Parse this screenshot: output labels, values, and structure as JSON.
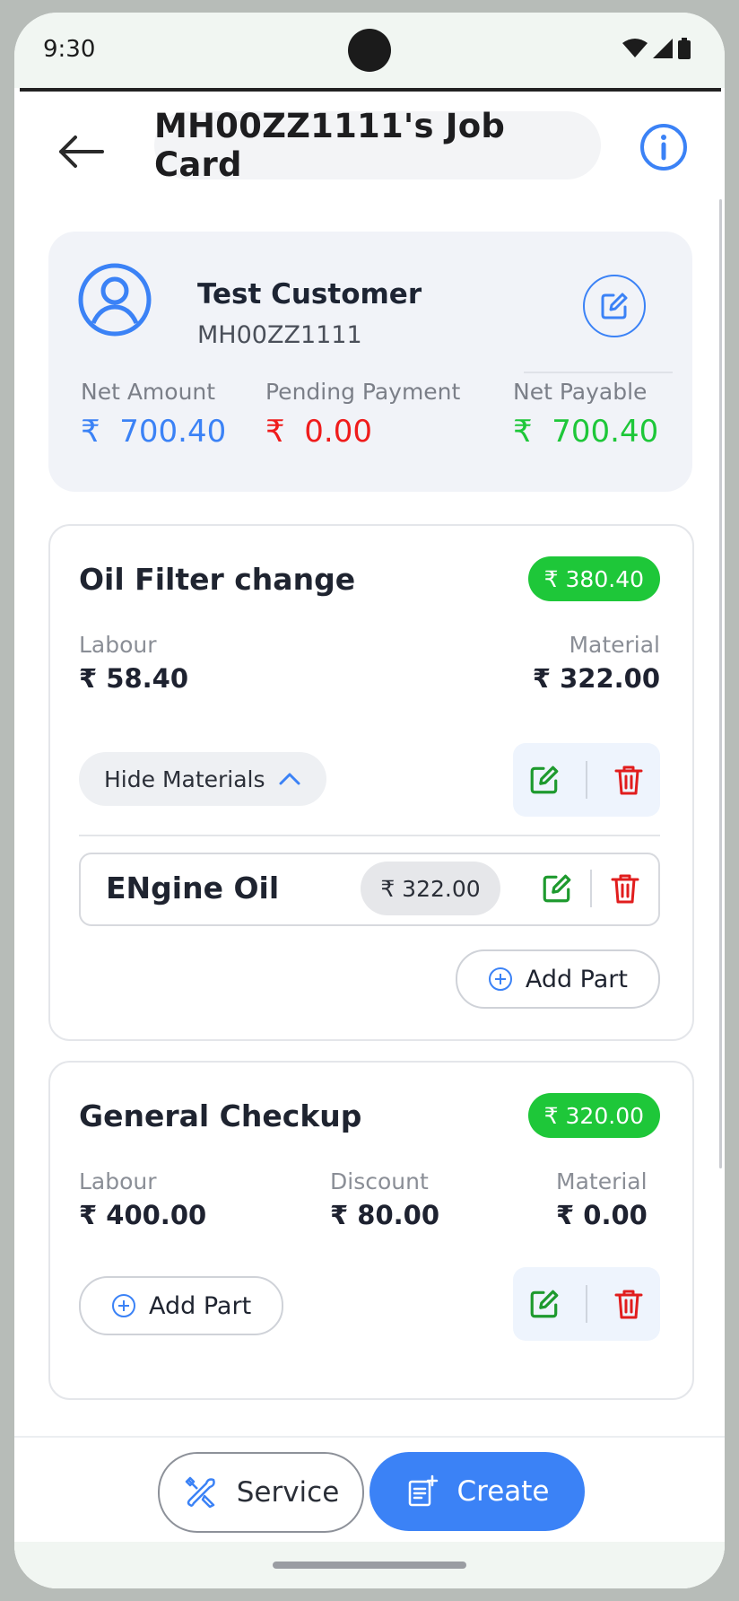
{
  "status_bar": {
    "time": "9:30"
  },
  "header": {
    "title": "MH00ZZ1111's Job Card"
  },
  "customer": {
    "name": "Test Customer",
    "registration": "MH00ZZ1111",
    "summary": [
      {
        "label": "Net Amount",
        "currency": "₹",
        "value": "700.40",
        "color": "#3b82f6"
      },
      {
        "label": "Pending Payment",
        "currency": "₹",
        "value": "0.00",
        "color": "#ef1c1c"
      },
      {
        "label": "Net Payable",
        "currency": "₹",
        "value": "700.40",
        "color": "#1ec739"
      }
    ]
  },
  "services": [
    {
      "title": "Oil Filter change",
      "price": "₹ 380.40",
      "labour_label": "Labour",
      "labour_value": "₹ 58.40",
      "material_label": "Material",
      "material_value": "₹ 322.00",
      "hide_materials_label": "Hide Materials",
      "materials": [
        {
          "name": "ENgine Oil",
          "price": "₹ 322.00"
        }
      ],
      "add_part_label": "Add Part"
    },
    {
      "title": "General Checkup",
      "price": "₹ 320.00",
      "labour_label": "Labour",
      "labour_value": "₹ 400.00",
      "discount_label": "Discount",
      "discount_value": "₹ 80.00",
      "material_label": "Material",
      "material_value": "₹ 0.00",
      "add_part_label": "Add Part"
    }
  ],
  "bottom": {
    "service_label": "Service",
    "create_label": "Create"
  },
  "colors": {
    "accent": "#3b82f6",
    "success": "#1ec739",
    "danger": "#ef1c1c"
  }
}
